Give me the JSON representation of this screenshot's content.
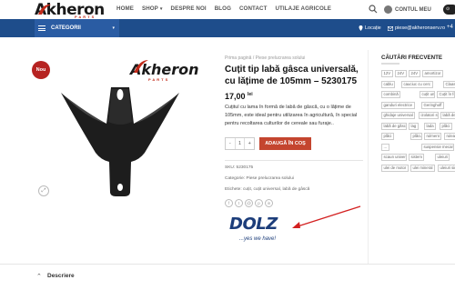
{
  "logo": {
    "brand": "Akheron",
    "sub": "PARTS"
  },
  "nav": {
    "items": [
      "HOME",
      "SHOP",
      "DESPRE NOI",
      "BLOG",
      "CONTACT",
      "UTILAJE AGRICOLE"
    ],
    "account_label": "CONTUL MEU"
  },
  "bluebar": {
    "categories_label": "CATEGORII",
    "location_label": "Locație",
    "email": "piese@akheronserv.ro",
    "phone_partial": "+4"
  },
  "product": {
    "badge": "Nou",
    "breadcrumb": [
      "Prima pagină",
      "Piese prelucrarea solului"
    ],
    "title": "Cuțit tip labă gâsca universală, cu lățime de 105mm – 5230175",
    "price": "17,00",
    "currency": "lei",
    "short_description": "Cuțitul cu lama în formă de labă de gâscă, cu o lățime de 105mm, este ideal pentru utilizarea în agricultură, în special pentru recoltarea culturilor de cereale sau furaje..",
    "quantity": "1",
    "qty_minus": "-",
    "qty_plus": "+",
    "add_to_cart": "ADAUGĂ ÎN COȘ",
    "sku": "SKU: 5230175",
    "category": "Categorie: Piese prelucrarea solului",
    "tags": "Etichete: cuțit, cuțit universal, labă de gâscă",
    "image_brand": "Akheron",
    "image_brand_sub": "PARTS"
  },
  "dolz": {
    "word": "DOLZ",
    "tagline": "...yes we have!"
  },
  "sidebar": {
    "title": "CĂUTĂRI FRECVENTE",
    "tags": [
      "12V",
      "24V",
      "24V",
      "amortizor",
      "cablu",
      "cauciuc cu cerc",
      "Claas",
      "combină",
      "cuțit universal",
      "Cuțit în formă de L",
      "ganduri electrice",
      "Geringhoff",
      "ghid",
      "ghidaje universal",
      "izolatori stilistic",
      "labă de gâscă",
      "labă de găscă",
      "lag",
      "lada",
      "plăci",
      "plăci",
      "plăcuțe",
      "rulment",
      "ruleaz",
      "...",
      "suspensie mecanică",
      "scaun universal",
      "sistem",
      "uleiuri",
      "ulei de motor",
      "ulei mineral",
      "uleiuri sintetic"
    ]
  },
  "bottom": {
    "description_tab": "Descriere"
  },
  "icons": {
    "search": "search-icon",
    "user": "user-icon",
    "cart": "cart-icon",
    "location": "location-pin-icon",
    "mail": "mail-icon",
    "zoom": "zoom-expand-icon",
    "hamburger": "hamburger-icon"
  },
  "colors": {
    "brand_blue": "#1e4d8b",
    "accent_red": "#c4452f",
    "badge_red": "#b62321"
  }
}
